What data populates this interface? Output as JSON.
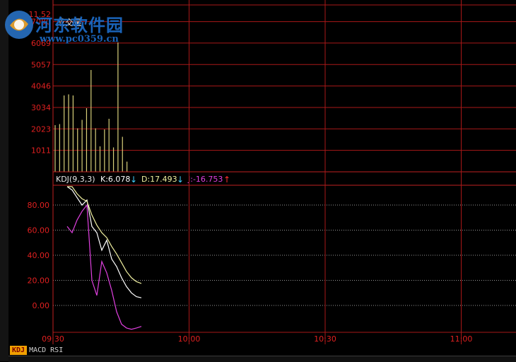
{
  "volume_panel": {
    "title": "成交量",
    "y_ticks": [
      "1011",
      "2023",
      "3034",
      "4046",
      "5057",
      "6069",
      "7080",
      "11.52"
    ]
  },
  "kdj_panel": {
    "name": "KDJ(9,3,3)",
    "k_label": "K:6.078",
    "d_label": "D:17.493",
    "j_label": "J:-16.753",
    "k_trend": "down",
    "d_trend": "down",
    "j_trend": "up",
    "y_ticks": [
      "80.00",
      "60.00",
      "40.00",
      "20.00",
      "0.00"
    ]
  },
  "time_axis": [
    "09:30",
    "10:00",
    "10:30",
    "11:00"
  ],
  "tabs": [
    {
      "label": "KDJ",
      "active": true
    },
    {
      "label": "MACD",
      "active": false
    },
    {
      "label": "RSI",
      "active": false
    }
  ],
  "watermark": {
    "text": "河东软件园",
    "url": "www.pc0359.cn"
  },
  "colors": {
    "grid": "#a81818",
    "axis_text": "#e02020",
    "volume_bar": "#d8d07a",
    "k_line": "#ffffff",
    "d_line": "#f0f0a0",
    "j_line": "#e040e0",
    "k_arrow": "#40d0ff",
    "j_arrow": "#ff3030",
    "watermark": "#1a63b8"
  },
  "chart_data": [
    {
      "type": "bar",
      "title": "成交量",
      "x": [
        1,
        2,
        3,
        4,
        5,
        6,
        7,
        8,
        9,
        10,
        11,
        12,
        13,
        14,
        15,
        16,
        17,
        18
      ],
      "values": [
        2200,
        2250,
        3600,
        3650,
        3600,
        2050,
        2450,
        3000,
        4800,
        2050,
        1200,
        2000,
        2500,
        1150,
        6100,
        1650,
        480,
        0
      ],
      "ylim": [
        0,
        8100
      ],
      "yticks": [
        1011,
        2023,
        3034,
        4046,
        5057,
        6069,
        7080
      ]
    },
    {
      "type": "line",
      "title": "KDJ(9,3,3)",
      "x": [
        1,
        2,
        3,
        4,
        5,
        6,
        7,
        8,
        9,
        10,
        11,
        12,
        13,
        14,
        15,
        16
      ],
      "ylim": [
        -25,
        100
      ],
      "yticks": [
        80,
        60,
        40,
        20,
        0
      ],
      "series": [
        {
          "name": "K",
          "values": [
            100,
            92,
            86,
            80,
            84,
            63,
            58,
            44,
            52,
            37,
            31,
            22,
            15,
            10,
            7,
            6.078
          ]
        },
        {
          "name": "D",
          "values": [
            100,
            95,
            89,
            85,
            83,
            72,
            64,
            58,
            54,
            47,
            41,
            34,
            27,
            22,
            19,
            17.493
          ]
        },
        {
          "name": "J",
          "values": [
            63,
            58,
            68,
            75,
            80,
            20,
            8,
            35,
            26,
            12,
            -5,
            -15,
            -18,
            -19,
            -18,
            -16.753
          ]
        }
      ]
    }
  ]
}
